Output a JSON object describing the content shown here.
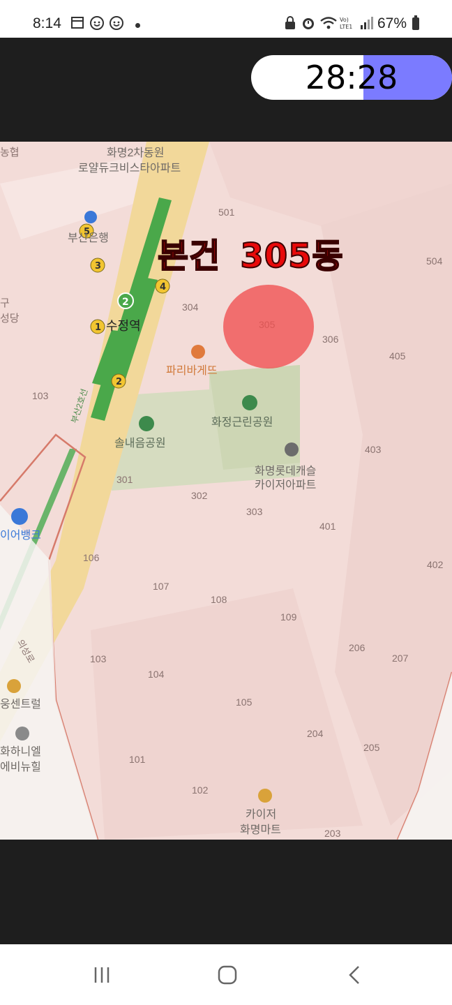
{
  "status_bar": {
    "time": "8:14",
    "battery": "67%"
  },
  "timer": {
    "text": "28:28",
    "fill_fraction": 0.44
  },
  "map": {
    "headline_left": "본건",
    "headline_right": "305동",
    "top_labels": [
      "화명2차동원",
      "로얄듀크비스타아파트"
    ],
    "bank": "부산은행",
    "station": "수정역",
    "line_label": "부산2호선",
    "bakery": "파리바게뜨",
    "park1": "화정근린공원",
    "park2": "솔내음공원",
    "apt_name_1": "화명롯데캐슬",
    "apt_name_2": "카이저아파트",
    "left_partial_1": "농협",
    "left_partial_2": "구",
    "left_partial_3": "성당",
    "left_partial_4": "이어뱅크",
    "left_partial_5": "웅센트럴",
    "left_partial_6": "화하니엘",
    "left_partial_7": "에비뉴힐",
    "road_label": "의성로",
    "mart_1": "카이저",
    "mart_2": "화명마트",
    "buildings": [
      "501",
      "504",
      "304",
      "305",
      "306",
      "405",
      "103",
      "403",
      "301",
      "302",
      "303",
      "401",
      "106",
      "402",
      "107",
      "108",
      "109",
      "206",
      "207",
      "103",
      "104",
      "105",
      "204",
      "205",
      "101",
      "102",
      "203"
    ]
  },
  "nav": {
    "recents": "recents-icon",
    "home": "home-icon",
    "back": "back-icon"
  }
}
